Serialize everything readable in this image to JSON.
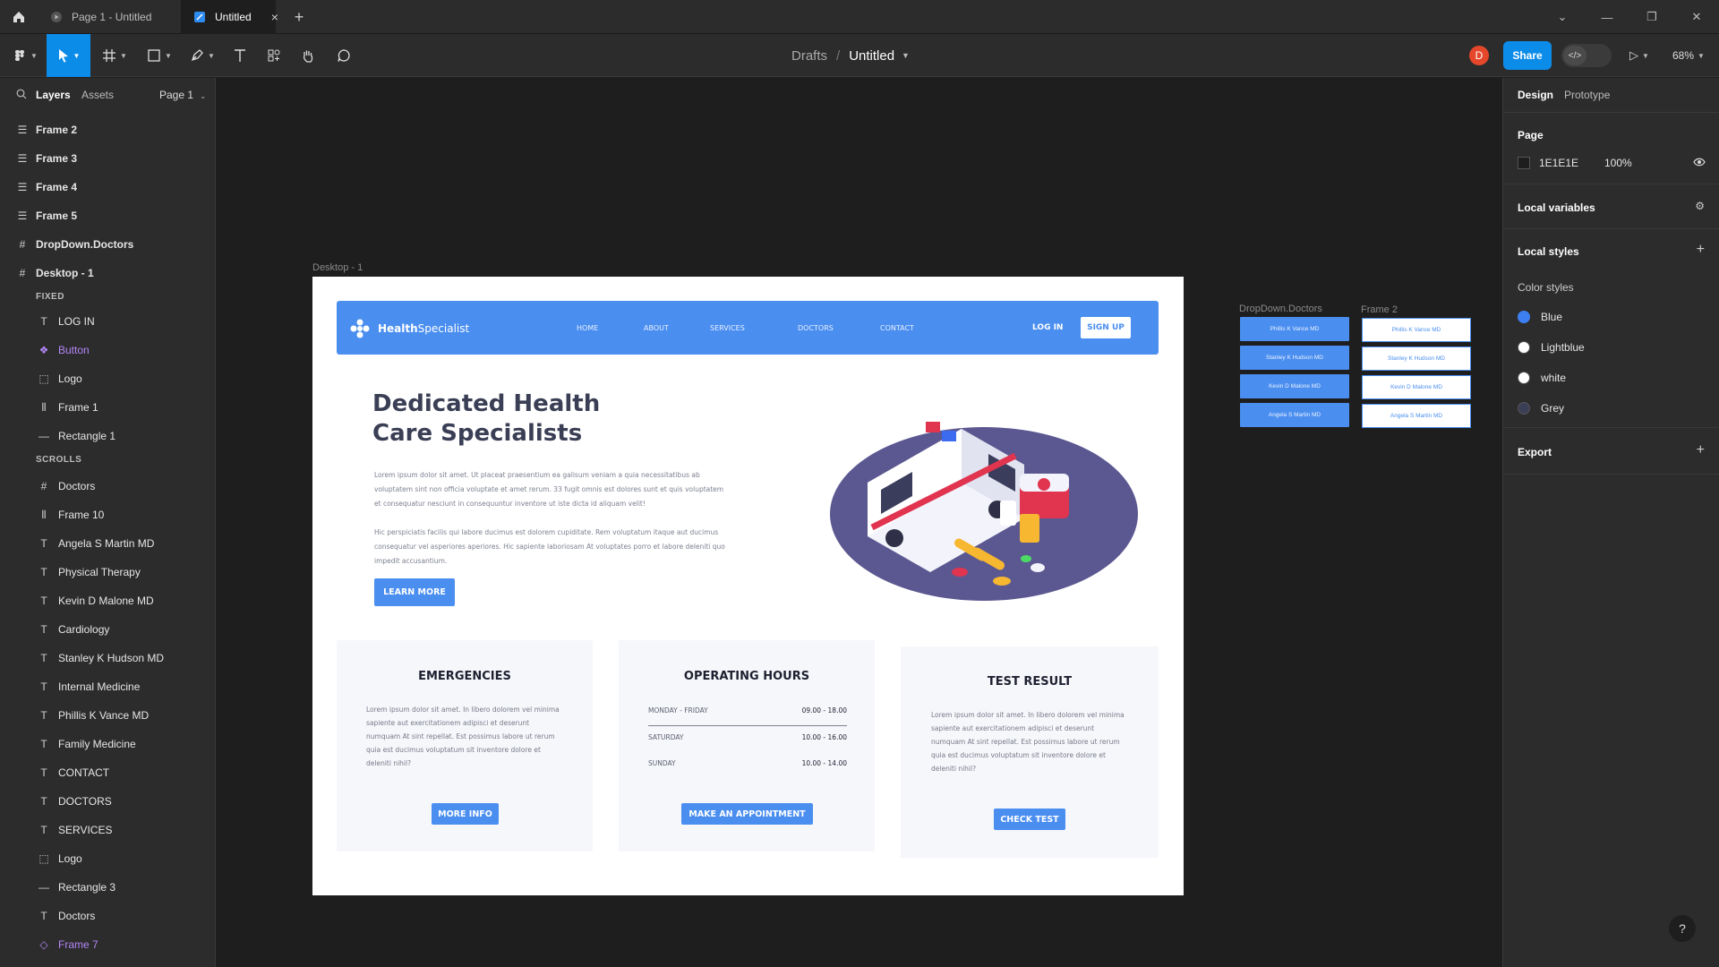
{
  "titlebar": {
    "tabs": [
      {
        "label": "Page 1 - Untitled"
      },
      {
        "label": "Untitled"
      }
    ]
  },
  "toolbar": {
    "breadcrumb_parent": "Drafts",
    "breadcrumb_sep": "/",
    "file_name": "Untitled",
    "avatar_initial": "D",
    "share_label": "Share",
    "zoom": "68%"
  },
  "left_panel": {
    "tab_layers": "Layers",
    "tab_assets": "Assets",
    "page_selector": "Page 1",
    "top_layers": [
      "Frame 2",
      "Frame 3",
      "Frame 4",
      "Frame 5",
      "DropDown.Doctors",
      "Desktop - 1"
    ],
    "group_fixed": "FIXED",
    "fixed_children": [
      "LOG IN",
      "Button",
      "Logo",
      "Frame 1",
      "Rectangle 1"
    ],
    "group_scrolls": "SCROLLS",
    "scroll_children": [
      "Doctors",
      "Frame 10",
      "Angela S Martin MD",
      "Physical Therapy",
      "Kevin D Malone MD",
      "Cardiology",
      "Stanley K Hudson MD",
      "Internal Medicine",
      "Phillis K Vance MD",
      "Family Medicine",
      "CONTACT",
      "DOCTORS",
      "SERVICES",
      "Logo",
      "Rectangle 3",
      "Doctors",
      "Frame 7"
    ]
  },
  "right_panel": {
    "tab_design": "Design",
    "tab_prototype": "Prototype",
    "page_label": "Page",
    "page_color_hex": "1E1E1E",
    "page_opacity": "100%",
    "local_variables": "Local variables",
    "local_styles": "Local styles",
    "color_styles_label": "Color styles",
    "color_styles": [
      {
        "name": "Blue",
        "color": "#3d7ff0"
      },
      {
        "name": "Lightblue",
        "color": "#ffffff"
      },
      {
        "name": "white",
        "color": "#ffffff"
      },
      {
        "name": "Grey",
        "color": "#3b3f55"
      }
    ],
    "export": "Export",
    "help": "?"
  },
  "canvas": {
    "desktop_label": "Desktop - 1",
    "dropdown_label": "DropDown.Doctors",
    "frame2_label": "Frame 2",
    "dropdown_items": [
      "Phillis K Vance MD",
      "Stanley K Hudson MD",
      "Kevin D Malone MD",
      "Angela S Martin MD"
    ]
  },
  "site": {
    "brand_bold": "Health",
    "brand_rest": "Specialist",
    "nav": [
      "HOME",
      "ABOUT",
      "SERVICES",
      "DOCTORS",
      "CONTACT"
    ],
    "login": "LOG IN",
    "signup": "SIGN UP",
    "hero_title": "Dedicated Health Care Specialists",
    "hero_p1": "Lorem ipsum dolor sit amet. Ut placeat praesentium ea galisum veniam a quia necessitatibus ab voluptatem sint non officia voluptate et amet rerum. 33 fugit omnis est dolores sunt et quis voluptatem et consequatur nesciunt in consequuntur inventore ut iste dicta id aliquam velit!",
    "hero_p2": "Hic perspiciatis facilis qui labore ducimus est dolorem cupiditate. Rem voluptatum itaque aut ducimus consequatur vel asperiores aperiores. Hic sapiente laboriosam At voluptates porro et labore deleniti quo impedit accusantium.",
    "learn_more": "LEARN MORE",
    "cards": {
      "emergencies_title": "EMERGENCIES",
      "emergencies_p": "Lorem ipsum dolor sit amet. In libero dolorem vel minima sapiente aut exercitationem adipisci et deserunt numquam At sint repellat. Est possimus labore ut rerum quia est ducimus voluptatum sit inventore dolore et deleniti nihil?",
      "emergencies_btn": "MORE INFO",
      "hours_title": "OPERATING HOURS",
      "hours": [
        {
          "day": "MONDAY - FRIDAY",
          "time": "09.00 - 18.00"
        },
        {
          "day": "SATURDAY",
          "time": "10.00 - 16.00"
        },
        {
          "day": "SUNDAY",
          "time": "10.00 - 14.00"
        }
      ],
      "hours_btn": "MAKE AN APPOINTMENT",
      "test_title": "TEST RESULT",
      "test_p": "Lorem ipsum dolor sit amet. In libero dolorem vel minima sapiente aut exercitationem adipisci et deserunt numquam At sint repellat. Est possimus labore ut rerum quia est ducimus voluptatum sit inventore dolore et deleniti nihil?",
      "test_btn": "CHECK TEST"
    }
  }
}
